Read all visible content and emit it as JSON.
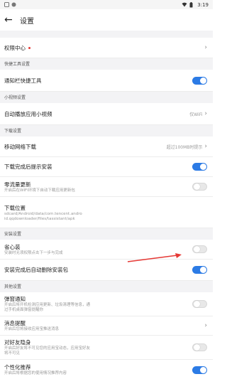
{
  "statusbar": {
    "time": "3:19"
  },
  "header": {
    "back_glyph": "←",
    "title": "设置"
  },
  "permission": {
    "label": "权限中心",
    "chevron": "›"
  },
  "sections": {
    "quick_tools": "快捷工具设置",
    "short_video": "小视频设置",
    "download": "下载设置",
    "install": "安装设置",
    "other": "其他设置"
  },
  "rows": {
    "notify_tools": {
      "title": "通知栏快捷工具",
      "toggle": true
    },
    "auto_play": {
      "title": "自动播放应用小视频",
      "value": "仅WiFi",
      "chevron": "›"
    },
    "mobile_download": {
      "title": "移动网络下载",
      "value": "超过100MB时提示",
      "chevron": "›"
    },
    "download_done_prompt": {
      "title": "下载完成后提示安装",
      "toggle": true
    },
    "zero_traffic": {
      "title": "零流量更新",
      "subtitle": "开启后在WIFI环境下自动下载应用更新包",
      "toggle": false
    },
    "download_path": {
      "title": "下载位置",
      "subtitle": "sdcard/Android/data/com.tencent.android.qqdownloader/files/tassistant/apk"
    },
    "save_install": {
      "title": "省心装",
      "subtitle": "安装时无须权限点击下一步与完成",
      "toggle": false
    },
    "auto_delete": {
      "title": "安装完成后自动删除安装包",
      "toggle": true
    },
    "popup_notice": {
      "title": "弹窗通知",
      "subtitle": "开启后将开机检测应用更新、垃圾清理等信息，通过手机桌面弹窗提醒你",
      "toggle": false
    },
    "msg_remind": {
      "title": "消息提醒",
      "subtitle": "开启后您将接收应用宝推送消息",
      "chevron": "›"
    },
    "hide_friends": {
      "title": "对好友隐身",
      "subtitle": "开启后好友将不可见您的应用宝动态，应用宝好友将不可见",
      "toggle": false
    },
    "personalized": {
      "title": "个性化推荐",
      "subtitle": "开启后将根据您的使用情况推荐内容",
      "toggle": true
    }
  },
  "colors": {
    "accent": "#2c7be5",
    "annotation": "#e53935"
  }
}
